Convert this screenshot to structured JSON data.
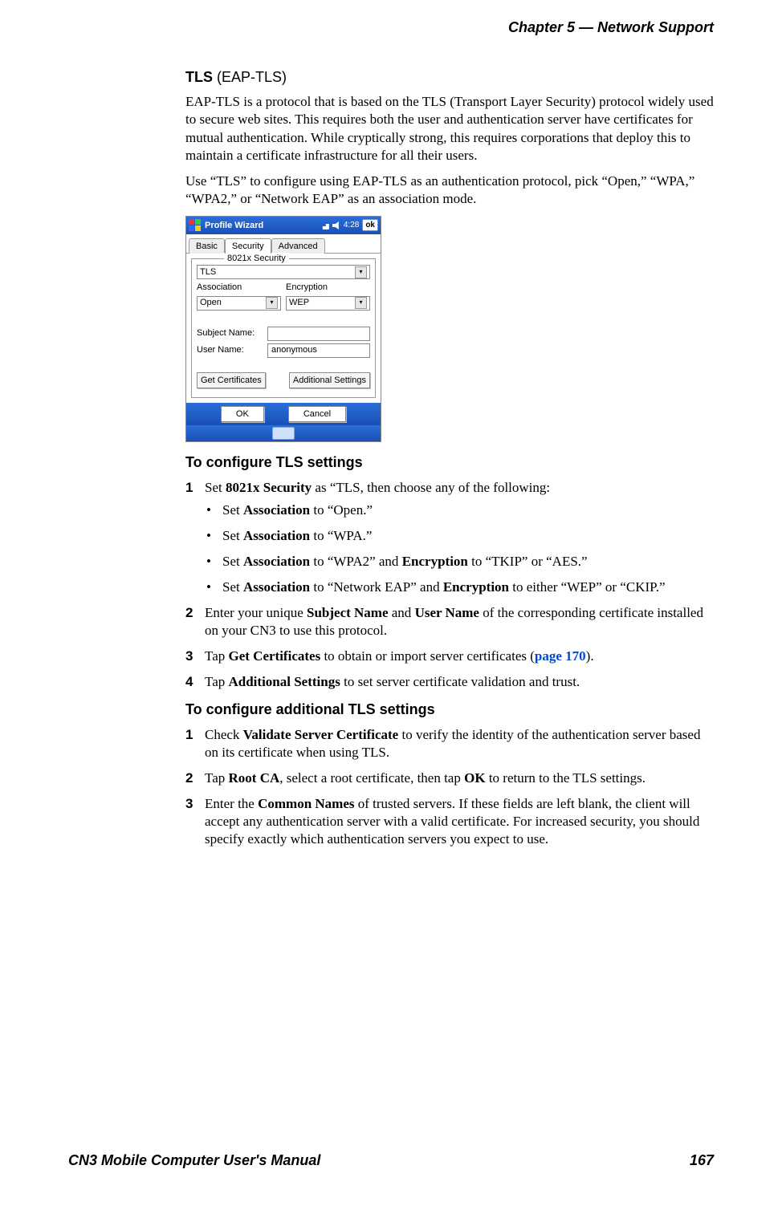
{
  "header": "Chapter 5 —  Network Support",
  "footer": {
    "left": "CN3 Mobile Computer User's Manual",
    "right": "167"
  },
  "section": {
    "title_bold": "TLS",
    "title_paren": " (EAP-TLS)",
    "para1": "EAP-TLS is a protocol that is based on the TLS (Transport Layer Security) protocol widely used to secure web sites. This requires both the user and authentication server have certificates for mutual authentication. While cryptically strong, this requires corporations that deploy this to maintain a certificate infrastructure for all their users.",
    "para2": "Use “TLS” to configure using EAP-TLS as an authentication protocol, pick “Open,” “WPA,” “WPA2,” or “Network EAP” as an association mode."
  },
  "shot": {
    "title": "Profile Wizard",
    "clock": "4:28",
    "ok": "ok",
    "tabs": {
      "basic": "Basic",
      "security": "Security",
      "advanced": "Advanced"
    },
    "panel_label": "8021x Security",
    "security_dd": "TLS",
    "lbl_assoc": "Association",
    "lbl_enc": "Encryption",
    "assoc_dd": "Open",
    "enc_dd": "WEP",
    "lbl_subj": "Subject Name:",
    "lbl_user": "User Name:",
    "user_val": "anonymous",
    "btn_getcert": "Get Certificates",
    "btn_addl": "Additional Settings",
    "btn_ok": "OK",
    "btn_cancel": "Cancel"
  },
  "h1": "To configure TLS settings",
  "step1_pre": "Set ",
  "step1_b1": "8021x Security",
  "step1_post": " as “TLS, then choose any of the following:",
  "bul1_pre": "Set ",
  "bul1_b": "Association",
  "bul1_post": " to “Open.”",
  "bul2_pre": "Set ",
  "bul2_b": "Association",
  "bul2_post": " to “WPA.”",
  "bul3_pre": "Set ",
  "bul3_b1": "Association",
  "bul3_mid": " to “WPA2” and ",
  "bul3_b2": "Encryption",
  "bul3_post": " to “TKIP” or “AES.”",
  "bul4_pre": "Set ",
  "bul4_b1": "Association",
  "bul4_mid": " to “Network EAP” and ",
  "bul4_b2": "Encryption",
  "bul4_post": " to either “WEP” or “CKIP.”",
  "step2_pre": "Enter your unique ",
  "step2_b1": "Subject Name",
  "step2_mid": " and ",
  "step2_b2": "User Name",
  "step2_post": " of the corresponding certificate installed on your CN3 to use this protocol.",
  "step3_pre": "Tap ",
  "step3_b": "Get Certificates",
  "step3_mid": " to obtain or import server certificates (",
  "step3_link": "page 170",
  "step3_post": ").",
  "step4_pre": "Tap ",
  "step4_b": "Additional Settings",
  "step4_post": " to set server certificate validation and trust.",
  "h2": "To configure additional TLS settings",
  "a1_pre": "Check ",
  "a1_b": "Validate Server Certificate",
  "a1_post": " to verify the identity of the authentication server based on its certificate when using TLS.",
  "a2_pre": "Tap ",
  "a2_b1": "Root CA",
  "a2_mid": ", select a root certificate, then tap ",
  "a2_b2": "OK",
  "a2_post": " to return to the TLS settings.",
  "a3_pre": "Enter the ",
  "a3_b": "Common Names",
  "a3_post": " of trusted servers. If these fields are left blank, the client will accept any authentication server with a valid certificate. For increased security, you should specify exactly which authentication servers you expect to use.",
  "nums": {
    "n1": "1",
    "n2": "2",
    "n3": "3",
    "n4": "4"
  }
}
